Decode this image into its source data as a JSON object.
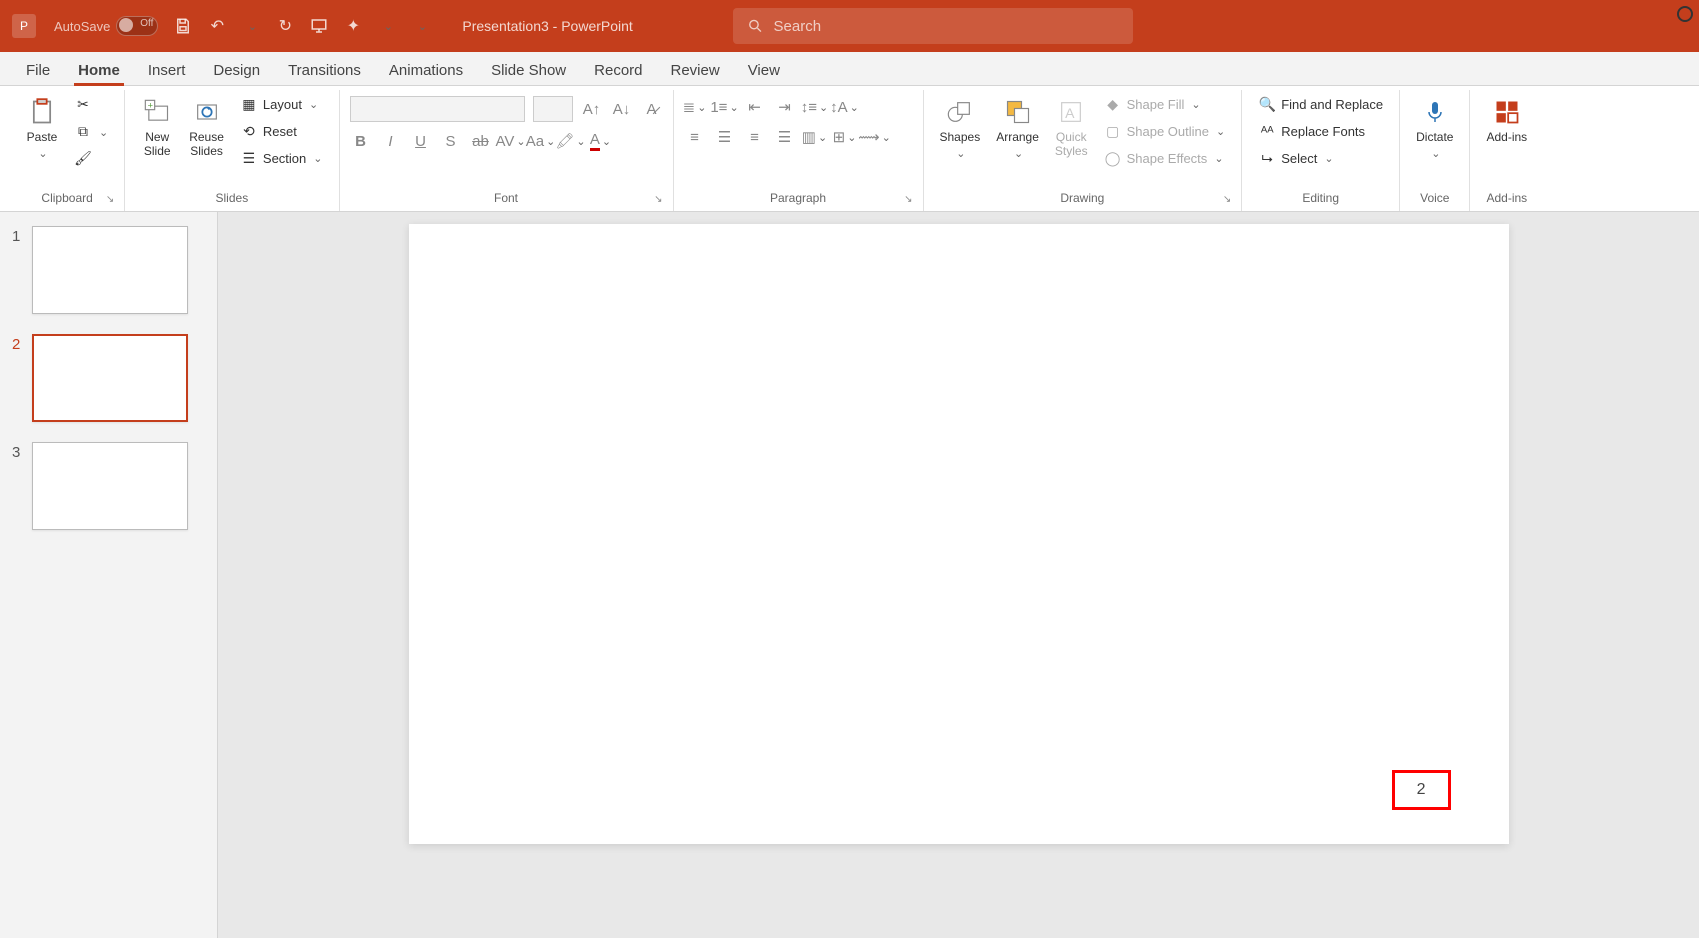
{
  "titlebar": {
    "autosave_label": "AutoSave",
    "autosave_state": "Off",
    "document_title": "Presentation3  -  PowerPoint",
    "search_placeholder": "Search"
  },
  "tabs": [
    "File",
    "Home",
    "Insert",
    "Design",
    "Transitions",
    "Animations",
    "Slide Show",
    "Record",
    "Review",
    "View"
  ],
  "active_tab_index": 1,
  "ribbon": {
    "clipboard": {
      "label": "Clipboard",
      "paste": "Paste"
    },
    "slides": {
      "label": "Slides",
      "new_slide": "New\nSlide",
      "reuse": "Reuse\nSlides",
      "layout": "Layout",
      "reset": "Reset",
      "section": "Section"
    },
    "font": {
      "label": "Font"
    },
    "paragraph": {
      "label": "Paragraph"
    },
    "drawing": {
      "label": "Drawing",
      "shapes": "Shapes",
      "arrange": "Arrange",
      "quick": "Quick\nStyles",
      "fill": "Shape Fill",
      "outline": "Shape Outline",
      "effects": "Shape Effects"
    },
    "editing": {
      "label": "Editing",
      "find": "Find and Replace",
      "replace_fonts": "Replace Fonts",
      "select": "Select"
    },
    "voice": {
      "label": "Voice",
      "dictate": "Dictate"
    },
    "addins": {
      "label": "Add-ins",
      "addins": "Add-ins"
    }
  },
  "thumbnails": {
    "items": [
      {
        "n": "1"
      },
      {
        "n": "2"
      },
      {
        "n": "3"
      }
    ],
    "active_index": 1
  },
  "canvas": {
    "slide_number": "2"
  }
}
